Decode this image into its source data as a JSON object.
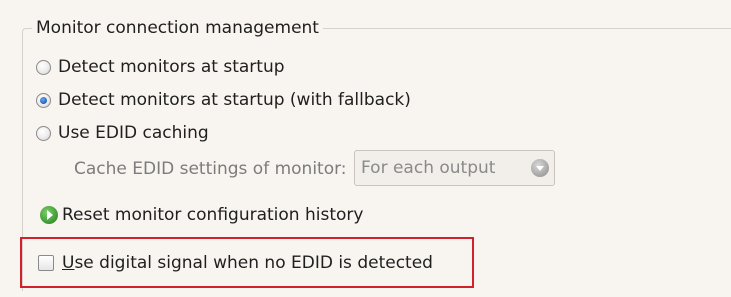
{
  "group": {
    "title": "Monitor connection management"
  },
  "options": {
    "detect_startup": {
      "label": "Detect monitors at startup",
      "checked": false
    },
    "detect_fallback": {
      "label": "Detect monitors at startup (with fallback)",
      "checked": true
    },
    "edid_caching": {
      "label": "Use EDID caching",
      "checked": false
    }
  },
  "cache": {
    "label": "Cache EDID settings of monitor:",
    "selected": "For each output"
  },
  "reset": {
    "label": "Reset monitor configuration history"
  },
  "digital_signal": {
    "underlined_char": "U",
    "label_rest": "se digital signal when no EDID is detected",
    "checked": false
  },
  "colors": {
    "highlight_border": "#d2212d",
    "panel_background": "#f8f4ef",
    "radio_selected": "#1f5fb8",
    "reset_icon": "#3f9a35"
  },
  "icons": {
    "radio": "radio-button-icon",
    "dropdown": "chevron-down-icon",
    "reset": "arrow-right-icon",
    "checkbox": "checkbox-icon"
  }
}
